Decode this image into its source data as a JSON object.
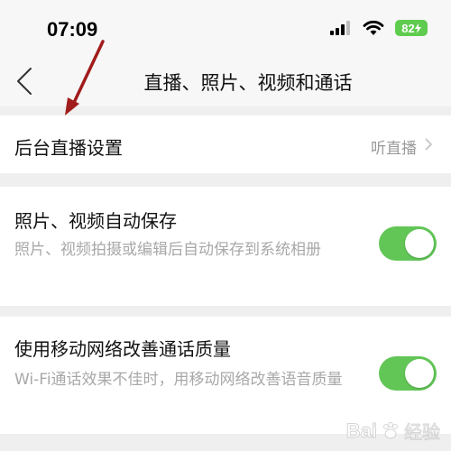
{
  "status_bar": {
    "time": "07:09",
    "battery": "82"
  },
  "nav": {
    "title": "直播、照片、视频和通话"
  },
  "settings": [
    {
      "title": "后台直播设置",
      "value": "听直播"
    },
    {
      "title": "照片、视频自动保存",
      "description": "照片、视频拍摄或编辑后自动保存到系统相册",
      "toggle_on": true
    },
    {
      "title": "使用移动网络改善通话质量",
      "description": "Wi-Fi通话效果不佳时，用移动网络改善语音质量",
      "toggle_on": true
    }
  ],
  "watermark": {
    "brand": "Bai",
    "suffix": "经验"
  },
  "colors": {
    "toggle_on": "#62c657",
    "annotation_arrow": "#a11c1c",
    "battery": "#5fcc4f"
  },
  "icons": [
    "back-chevron-icon",
    "signal-icon",
    "wifi-icon",
    "battery-icon",
    "chevron-right-icon",
    "paw-icon"
  ]
}
